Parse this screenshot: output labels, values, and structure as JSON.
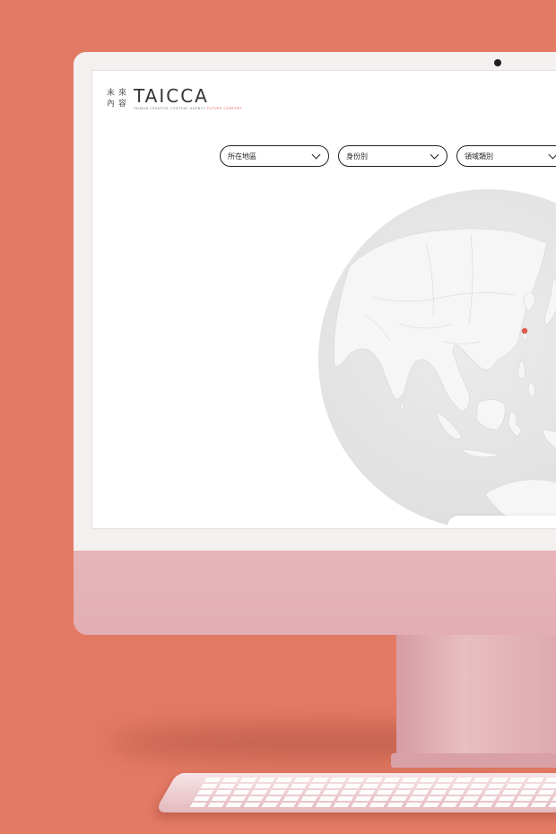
{
  "logo": {
    "cjk": [
      "未",
      "來",
      "內",
      "容"
    ],
    "wordmark": "TAICCA",
    "tagline_main": "TAIWAN CREATIVE CONTENT AGENCY",
    "tagline_accent": "FUTURE CONTENT"
  },
  "filters": [
    {
      "label": "所在地區"
    },
    {
      "label": "身份別"
    },
    {
      "label": "領域類別"
    }
  ],
  "map": {
    "marker_color": "#E05B4B",
    "globe_color": "#E3E3E3"
  },
  "colors": {
    "background": "#E37A64",
    "imac_body": "#F2DCDD",
    "imac_chin": "#E4B2B7"
  }
}
